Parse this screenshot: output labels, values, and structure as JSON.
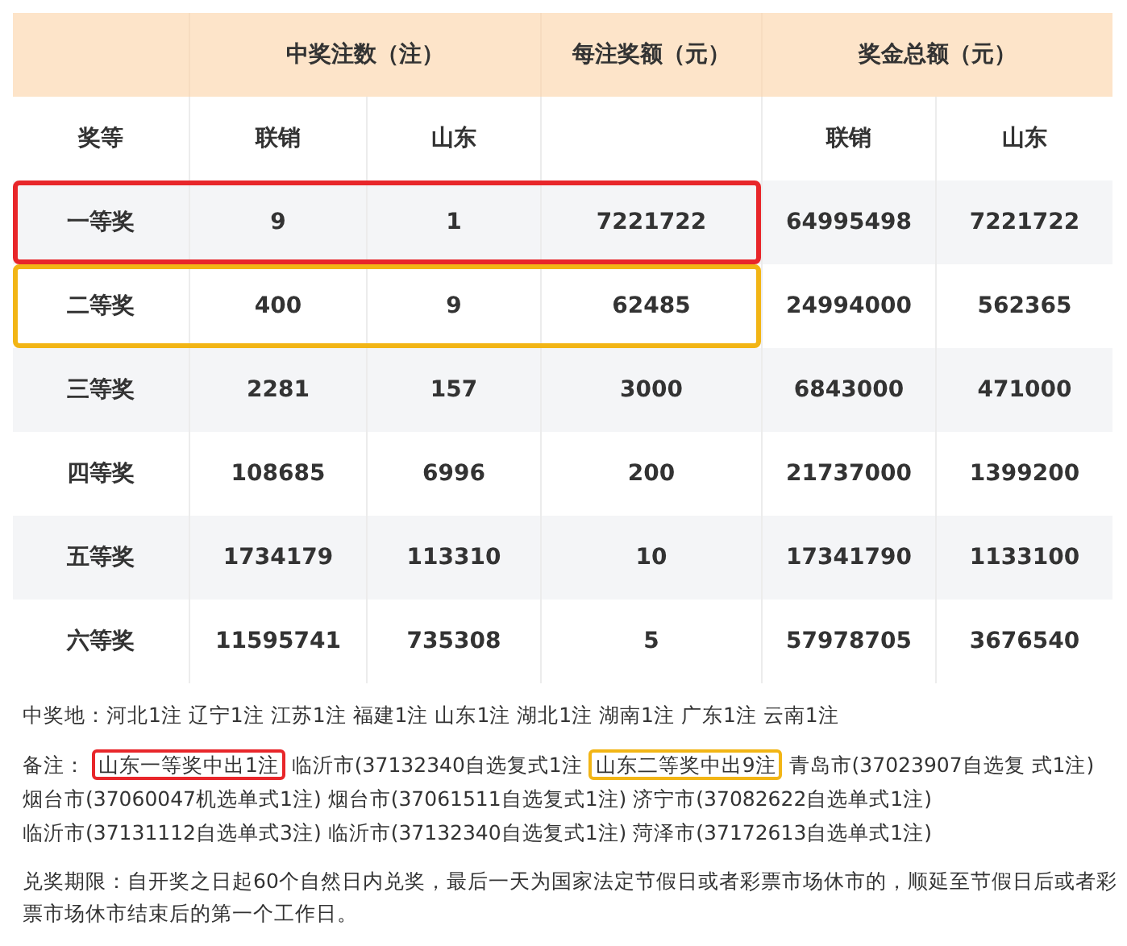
{
  "table": {
    "first_column": "奖等",
    "groups": [
      {
        "label": "中奖注数（注）",
        "subcolumns": [
          "联销",
          "山东"
        ]
      },
      {
        "label": "每注奖额（元）"
      },
      {
        "label": "奖金总额（元）",
        "subcolumns": [
          "联销",
          "山东"
        ]
      }
    ],
    "rows": [
      {
        "cells": [
          "一等奖",
          "9",
          "1",
          "7221722",
          "64995498",
          "7221722"
        ],
        "color": "#e8262a"
      },
      {
        "cells": [
          "二等奖",
          "400",
          "9",
          "62485",
          "24994000",
          "562365"
        ],
        "color": "#f2b515"
      },
      {
        "cells": [
          "三等奖",
          "2281",
          "157",
          "3000",
          "6843000",
          "471000"
        ]
      },
      {
        "cells": [
          "四等奖",
          "108685",
          "6996",
          "200",
          "21737000",
          "1399200"
        ]
      },
      {
        "cells": [
          "五等奖",
          "1734179",
          "113310",
          "10",
          "17341790",
          "1133100"
        ]
      },
      {
        "cells": [
          "六等奖",
          "11595741",
          "735308",
          "5",
          "57978705",
          "3676540"
        ]
      }
    ]
  },
  "winning_places": "中奖地：河北1注 辽宁1注 江苏1注 福建1注 山东1注 湖北1注 湖南1注 广东1注 云南1注",
  "notes": [
    {
      "text": "备注："
    },
    {
      "text": "山东一等奖中出1注",
      "color": "#e8262a"
    },
    {
      "text": "临沂市(37132340自选复式1注"
    },
    {
      "text": "山东二等奖中出9注",
      "color": "#f2b515"
    },
    {
      "text": "青岛市(37023907自选复"
    },
    {
      "text": "式1注)"
    },
    {
      "text": "烟台市(37060047机选单式1注)"
    },
    {
      "text": "烟台市(37061511自选复式1注)"
    },
    {
      "text": "济宁市(37082622自选单式1注)"
    },
    {
      "text": "临沂市(37131112自选单式3注)"
    },
    {
      "text": "临沂市(37132340自选复式1注)"
    },
    {
      "text": "菏泽市(37172613自选单式1注)"
    }
  ],
  "deadline": "兑奖期限：自开奖之日起60个自然日内兑奖，最后一天为国家法定节假日或者彩票市场休市的，顺延至节假日后或者彩票市场休市结束后的第一个工作日。"
}
